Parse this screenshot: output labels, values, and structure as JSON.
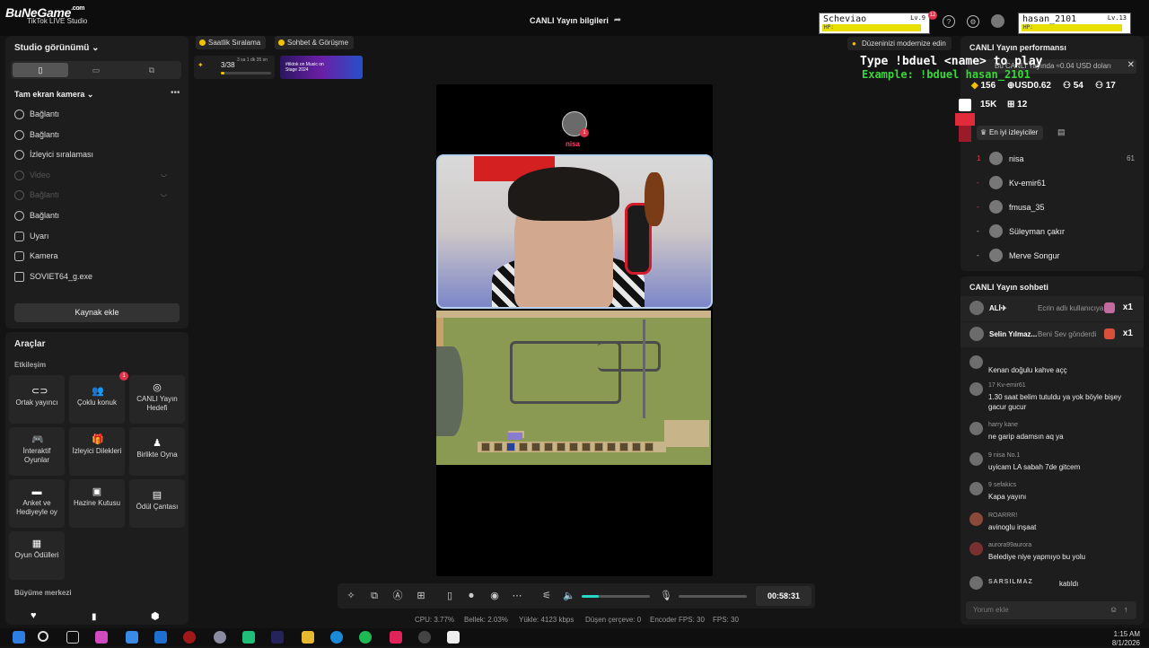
{
  "watermark": {
    "brand": "BuNeGame",
    "tld": ".com"
  },
  "app": {
    "title": "TikTok LIVE Studio"
  },
  "header": {
    "center_title": "CANLI Yayın bilgileri"
  },
  "game_overlay": {
    "player1": {
      "name": "Scheviao",
      "level": "Lv.9",
      "hp_label": "HP:"
    },
    "player2": {
      "name": "hasan_2101",
      "level": "Lv.13",
      "hp_label": "HP:"
    },
    "badge": "12",
    "instruction_line1": "Type !bduel <name> to play",
    "instruction_line2": "Example: !bduel hasan_2101"
  },
  "left_panel": {
    "title": "Studio görünümü",
    "camera_title": "Tam ekran kamera",
    "sources": [
      {
        "label": "Bağlantı",
        "enabled": true
      },
      {
        "label": "Bağlantı",
        "enabled": true
      },
      {
        "label": "İzleyici sıralaması",
        "enabled": true
      },
      {
        "label": "Video",
        "enabled": false
      },
      {
        "label": "Bağlantı",
        "enabled": false
      },
      {
        "label": "Bağlantı",
        "enabled": true
      },
      {
        "label": "Uyarı",
        "enabled": true
      },
      {
        "label": "Kamera",
        "enabled": true
      },
      {
        "label": "SOVIET64_g.exe",
        "enabled": true
      }
    ],
    "add_source": "Kaynak ekle"
  },
  "tools": {
    "title": "Araçlar",
    "section1": "Etkileşim",
    "tiles": [
      {
        "label": "Ortak yayıncı",
        "icon": "link-icon"
      },
      {
        "label": "Çoklu konuk",
        "icon": "users-icon",
        "badge": "1"
      },
      {
        "label": "CANLI Yayın Hedefi",
        "icon": "target-icon"
      },
      {
        "label": "İnteraktif Oyunlar",
        "icon": "gamepad-icon"
      },
      {
        "label": "İzleyici Dilekleri",
        "icon": "gift-icon"
      },
      {
        "label": "Birlikte Oyna",
        "icon": "play-together-icon"
      },
      {
        "label": "Anket ve Hediyeyle oy",
        "icon": "poll-icon"
      },
      {
        "label": "Hazine Kutusu",
        "icon": "treasure-icon"
      },
      {
        "label": "Ödül Çantası",
        "icon": "reward-bag-icon"
      },
      {
        "label": "Oyun Ödülleri",
        "icon": "game-reward-icon"
      }
    ],
    "section2": "Büyüme merkezi"
  },
  "chips": {
    "ranking": "Saatlik Sıralama",
    "chat": "Sohbet & Görüşme"
  },
  "goal": {
    "progress": "3/38",
    "timer": "3 sa 1 dk 35 sn",
    "fill": 0.08
  },
  "banner": {
    "text": "#tiktok on Music on Stage 2024"
  },
  "stream": {
    "top_avatar_name": "nisa",
    "top_avatar_badge": "1"
  },
  "controls": {
    "timer": "00:58:31",
    "volume": 0.25
  },
  "stats": {
    "cpu": "CPU: 3.77%",
    "memory": "Bellek: 2.03%",
    "upload": "Yükle: 4123 kbps",
    "dropped": "Düşen çerçeve: 0",
    "encoder": "Encoder FPS: 30",
    "fps": "FPS: 30"
  },
  "right": {
    "modernize": "Düzeninizi modernize edin",
    "perf_title": "CANLI Yayın performansı",
    "info": "Bu CANLI Yayında ≈0.04 USD doları",
    "stats": {
      "coins": "156",
      "usd": "USD0.62",
      "viewers": "54",
      "shares": "17",
      "likes": "15K",
      "gifts": "12"
    },
    "top_viewers_label": "En iyi izleyiciler",
    "top_viewers": [
      {
        "rank": "1",
        "name": "nisa",
        "score": "61"
      },
      {
        "rank": "-",
        "name": "Kv-emir61",
        "score": ""
      },
      {
        "rank": "-",
        "name": "fmusa_35",
        "score": ""
      },
      {
        "rank": "-",
        "name": "Süleyman çakır",
        "score": ""
      },
      {
        "rank": "-",
        "name": "Merve Songur",
        "score": ""
      }
    ]
  },
  "chat": {
    "title": "CANLI Yayın sohbeti",
    "gifts": [
      {
        "name": "ALİ✈",
        "msg": "Ecrin adlı kullanıcıya TikTok",
        "count": "x1"
      },
      {
        "name": "Selin Yılmaz...",
        "msg": "Beni Sev gönderdi",
        "count": "x1"
      }
    ],
    "messages": [
      {
        "user": "",
        "text": "Kenan doğulu kahve açç"
      },
      {
        "user": "17  Kv-emir61",
        "text": "1.30 saat belim tutuldu ya yok böyle bişey gacur gucur"
      },
      {
        "user": "harry kane",
        "text": "ne garip adamsın aq ya"
      },
      {
        "user": "9  nisa  No.1",
        "text": "uyicam LA sabah 7de gitcem"
      },
      {
        "user": "9  sefakics",
        "text": "Kapa yayını"
      },
      {
        "user": "ROARRR!",
        "text": "avinoglu inşaat"
      },
      {
        "user": "aurora99aurora",
        "text": "Belediye niye yapmıyo bu yolu"
      },
      {
        "user": "SARSILMAZ",
        "text": "katıldı"
      }
    ],
    "input_placeholder": "Yorum ekle"
  },
  "taskbar": {
    "time": "1:15 AM",
    "date": "8/1/2026"
  }
}
